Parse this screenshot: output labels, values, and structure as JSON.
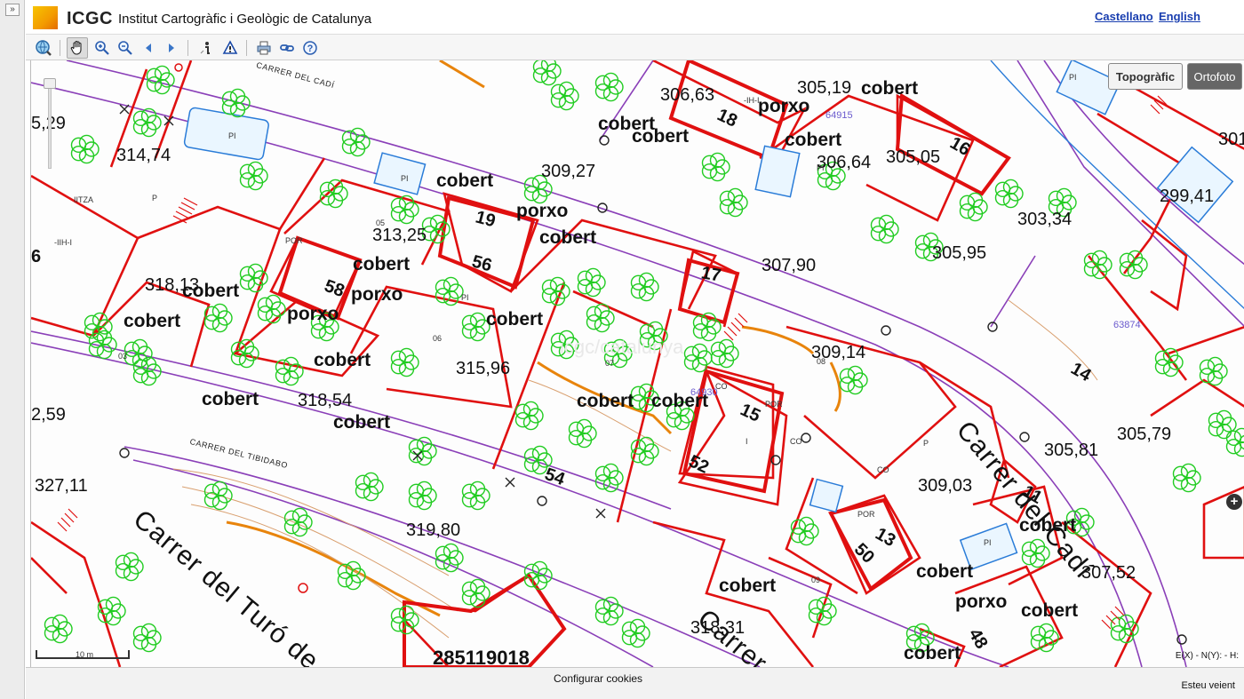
{
  "header": {
    "logo_text": "ICGC",
    "org_name": "Institut Cartogràfic i Geològic de Catalunya",
    "languages": [
      "Castellano",
      "English"
    ]
  },
  "toolbar": {
    "collapse_label": "»",
    "tools": [
      "globe-icon",
      "pan-hand-icon",
      "zoom-in-icon",
      "zoom-out-icon",
      "previous-view-icon",
      "next-view-icon",
      "info-icon",
      "warning-icon",
      "print-icon",
      "link-icon",
      "help-icon"
    ]
  },
  "map": {
    "basemaps": [
      "Topogràfic",
      "Ortofoto"
    ],
    "selected_basemap": "Topogràfic",
    "scale_label": "10 m",
    "coords_label": "E(X) - N(Y): - H:",
    "expand_label": "+",
    "road_labels": [
      "Carrer del Cadí",
      "Carrer del Turó de",
      "Carrer"
    ],
    "street_small": [
      "CARRER DEL CADÍ",
      "CARRER DEL TIBIDABO"
    ],
    "elevations": [
      "5,29",
      "314,74",
      "309,27",
      "313,25",
      "318,13",
      "315,96",
      "318,54",
      "2,59",
      "327,11",
      "319,80",
      "306,63",
      "305,19",
      "306,64",
      "305,05",
      "307,90",
      "303,34",
      "305,95",
      "299,41",
      "301",
      "309,14",
      "305,81",
      "309,03",
      "305,79",
      "307,52",
      "318,31"
    ],
    "coverage_labels": [
      "cobert",
      "cobert",
      "porxo",
      "cobert",
      "cobert",
      "cobert",
      "porxo",
      "cobert",
      "porxo",
      "cobert",
      "cobert",
      "cobert",
      "cobert",
      "cobert",
      "cobert",
      "cobert",
      "cobert",
      "cobert",
      "porxo",
      "cobert",
      "cobert",
      "cobert",
      "cobert",
      "cobert",
      "cobert",
      "porxo",
      "cobert",
      "cobert",
      "cobert"
    ],
    "house_numbers": [
      "19",
      "56",
      "58",
      "17",
      "18",
      "16",
      "15",
      "52",
      "54",
      "14",
      "13",
      "50",
      "11",
      "48",
      "6"
    ],
    "parcel_ref": "285119018",
    "parcel_ids": [
      "64915",
      "63874",
      "64930"
    ],
    "small_labels": [
      "PI",
      "PI",
      "PI",
      "PI",
      "PI",
      "PI",
      "05",
      "06",
      "07",
      "08",
      "03",
      "09",
      "POR",
      "POR",
      "POR",
      "CO",
      "CO",
      "CO",
      "I",
      "P",
      "P",
      "-IIH-I",
      "-IH-I",
      "IITZA"
    ],
    "watermark": "icgc/catalunya"
  },
  "footer": {
    "cookies": "Configurar cookies",
    "status": "Esteu veient"
  },
  "colors": {
    "parcel_red": "#e01010",
    "tree_green": "#22cc22",
    "street_purple": "#8a3fb8",
    "contour_orange": "#e8840c",
    "water_blue": "#2a7cd8"
  }
}
